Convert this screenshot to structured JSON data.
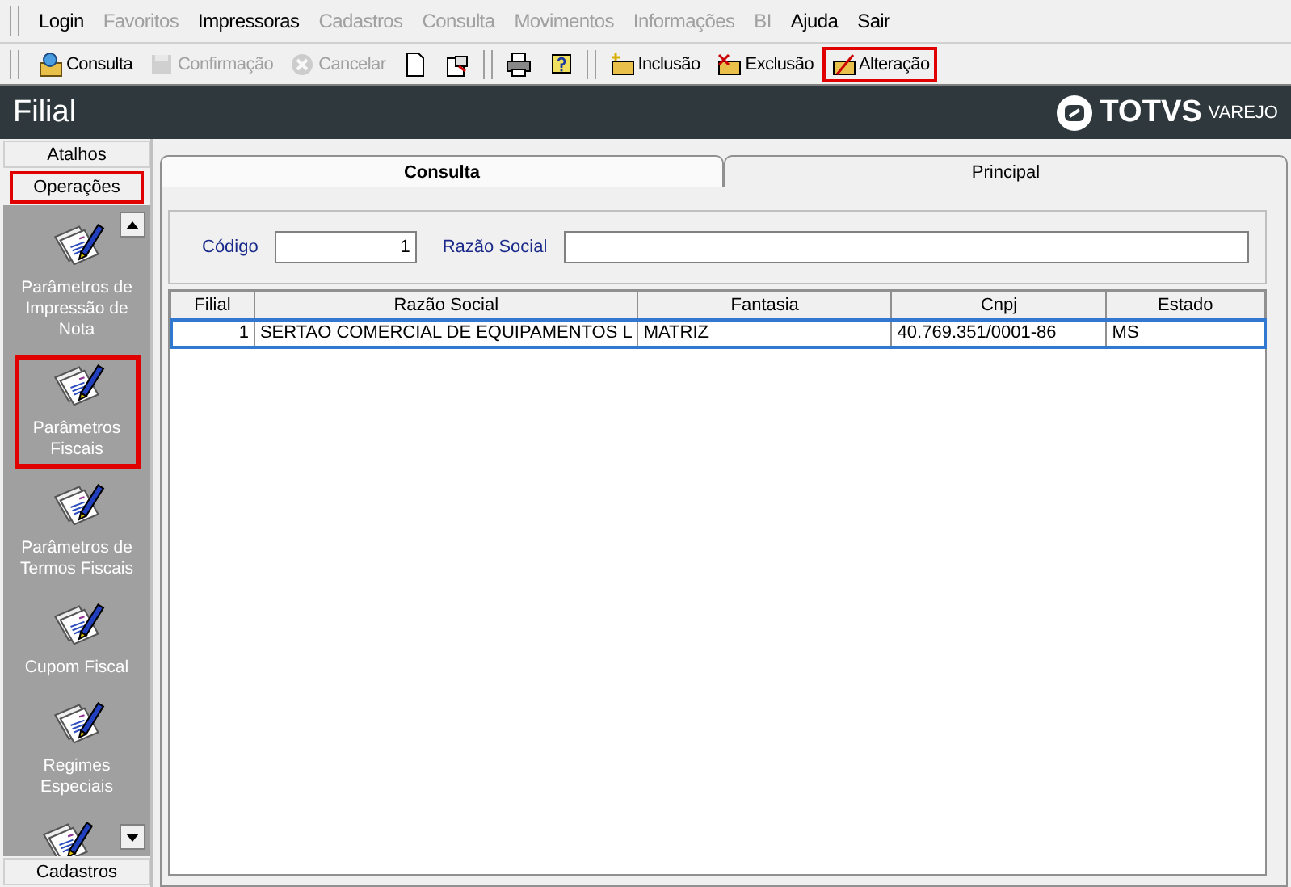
{
  "menu": [
    {
      "label": "Login",
      "disabled": false
    },
    {
      "label": "Favoritos",
      "disabled": true
    },
    {
      "label": "Impressoras",
      "disabled": false
    },
    {
      "label": "Cadastros",
      "disabled": true
    },
    {
      "label": "Consulta",
      "disabled": true
    },
    {
      "label": "Movimentos",
      "disabled": true
    },
    {
      "label": "Informações",
      "disabled": true
    },
    {
      "label": "BI",
      "disabled": true
    },
    {
      "label": "Ajuda",
      "disabled": false
    },
    {
      "label": "Sair",
      "disabled": false
    }
  ],
  "toolbar": [
    {
      "kind": "button",
      "label": "Consulta",
      "disabled": false,
      "highlighted": false
    },
    {
      "kind": "button",
      "label": "Confirmação",
      "disabled": true,
      "highlighted": false
    },
    {
      "kind": "button",
      "label": "Cancelar",
      "disabled": true,
      "highlighted": false
    },
    {
      "kind": "button",
      "disabled": false,
      "highlighted": false
    },
    {
      "kind": "button",
      "disabled": false,
      "highlighted": false
    },
    {
      "kind": "separator"
    },
    {
      "kind": "button",
      "disabled": false,
      "highlighted": false
    },
    {
      "kind": "button",
      "disabled": false,
      "highlighted": false
    },
    {
      "kind": "separator"
    },
    {
      "kind": "button",
      "label": "Inclusão",
      "disabled": false,
      "highlighted": false
    },
    {
      "kind": "button",
      "label": "Exclusão",
      "disabled": false,
      "highlighted": false
    },
    {
      "kind": "button",
      "label": "Alteração",
      "disabled": false,
      "highlighted": true
    }
  ],
  "header": {
    "title": "Filial",
    "logo": "TOTVS",
    "logo_suffix": "VAREJO"
  },
  "sidebar": {
    "sections": [
      {
        "label": "Atalhos",
        "highlighted": false
      },
      {
        "label": "Operações",
        "highlighted": true
      }
    ],
    "items": [
      {
        "label": "Parâmetros de Impressão de Nota",
        "highlighted": false
      },
      {
        "label": "Parâmetros Fiscais",
        "highlighted": true
      },
      {
        "label": "Parâmetros de Termos Fiscais",
        "highlighted": false
      },
      {
        "label": "Cupom Fiscal",
        "highlighted": false
      },
      {
        "label": "Regimes Especiais",
        "highlighted": false
      },
      {
        "highlighted": false
      }
    ],
    "footer_section": "Cadastros"
  },
  "tabs": [
    {
      "label": "Consulta",
      "selected": true
    },
    {
      "label": "Principal",
      "selected": false
    }
  ],
  "filters": {
    "codigo_label": "Código",
    "codigo_value": "1",
    "razao_label": "Razão Social"
  },
  "table": {
    "columns": [
      "Filial",
      "Razão Social",
      "Fantasia",
      "Cnpj",
      "Estado"
    ],
    "rows": [
      {
        "cells": [
          "1",
          "SERTAO COMERCIAL DE EQUIPAMENTOS L",
          "MATRIZ",
          "40.769.351/0001-86",
          "MS"
        ],
        "selected": true
      }
    ]
  }
}
